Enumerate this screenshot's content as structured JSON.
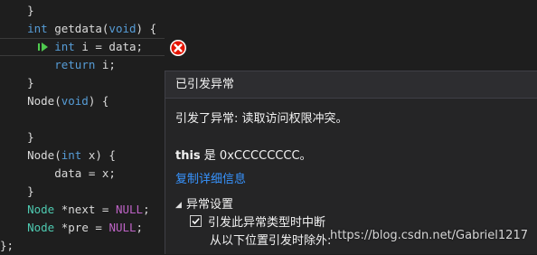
{
  "editor": {
    "lines": [
      {
        "tokens": [
          {
            "t": "    }",
            "c": "id"
          }
        ]
      },
      {
        "tokens": [
          {
            "t": "    ",
            "c": "id"
          },
          {
            "t": "int",
            "c": "kw"
          },
          {
            "t": " getdata(",
            "c": "id"
          },
          {
            "t": "void",
            "c": "kw"
          },
          {
            "t": ") {",
            "c": "id"
          }
        ]
      },
      {
        "tokens": [
          {
            "t": "        ",
            "c": "id"
          },
          {
            "t": "int",
            "c": "kw"
          },
          {
            "t": " i = data;",
            "c": "id"
          }
        ]
      },
      {
        "tokens": [
          {
            "t": "        ",
            "c": "id"
          },
          {
            "t": "return",
            "c": "kw"
          },
          {
            "t": " i;",
            "c": "id"
          }
        ]
      },
      {
        "tokens": [
          {
            "t": "    }",
            "c": "id"
          }
        ]
      },
      {
        "tokens": [
          {
            "t": "    Node(",
            "c": "id"
          },
          {
            "t": "void",
            "c": "kw"
          },
          {
            "t": ") {",
            "c": "id"
          }
        ]
      },
      {
        "tokens": [
          {
            "t": "",
            "c": "id"
          }
        ]
      },
      {
        "tokens": [
          {
            "t": "    }",
            "c": "id"
          }
        ]
      },
      {
        "tokens": [
          {
            "t": "    Node(",
            "c": "id"
          },
          {
            "t": "int",
            "c": "kw"
          },
          {
            "t": " x) {",
            "c": "id"
          }
        ]
      },
      {
        "tokens": [
          {
            "t": "        data = x;",
            "c": "id"
          }
        ]
      },
      {
        "tokens": [
          {
            "t": "    }",
            "c": "id"
          }
        ]
      },
      {
        "tokens": [
          {
            "t": "    ",
            "c": "id"
          },
          {
            "t": "Node",
            "c": "type-green"
          },
          {
            "t": " *next = ",
            "c": "id"
          },
          {
            "t": "NULL",
            "c": "macro"
          },
          {
            "t": ";",
            "c": "id"
          }
        ]
      },
      {
        "tokens": [
          {
            "t": "    ",
            "c": "id"
          },
          {
            "t": "Node",
            "c": "type-green"
          },
          {
            "t": " *pre = ",
            "c": "id"
          },
          {
            "t": "NULL",
            "c": "macro"
          },
          {
            "t": ";",
            "c": "id"
          }
        ]
      },
      {
        "tokens": [
          {
            "t": "};",
            "c": "id"
          }
        ]
      }
    ],
    "current_line_index": 2
  },
  "popup": {
    "title": "已引发异常",
    "message": "引发了异常: 读取访问权限冲突。",
    "this_keyword": "this",
    "this_rest": " 是 0xCCCCCCCC。",
    "copy_details_link": "复制详细信息",
    "settings_toggle_glyph": "◢",
    "settings_header": "异常设置",
    "break_on_type_label": "引发此异常类型时中断",
    "break_on_type_checked": true,
    "except_when_label": "从以下位置引发时除外:"
  },
  "watermark": "https://blog.csdn.net/Gabriel1217",
  "colors": {
    "editor_bg": "#1e1e1e",
    "keyword": "#569cd6",
    "type": "#4ec9b0",
    "macro": "#bd63c5",
    "link": "#3794ff",
    "error_red": "#e51400",
    "exec_arrow": "#4ec94e"
  }
}
